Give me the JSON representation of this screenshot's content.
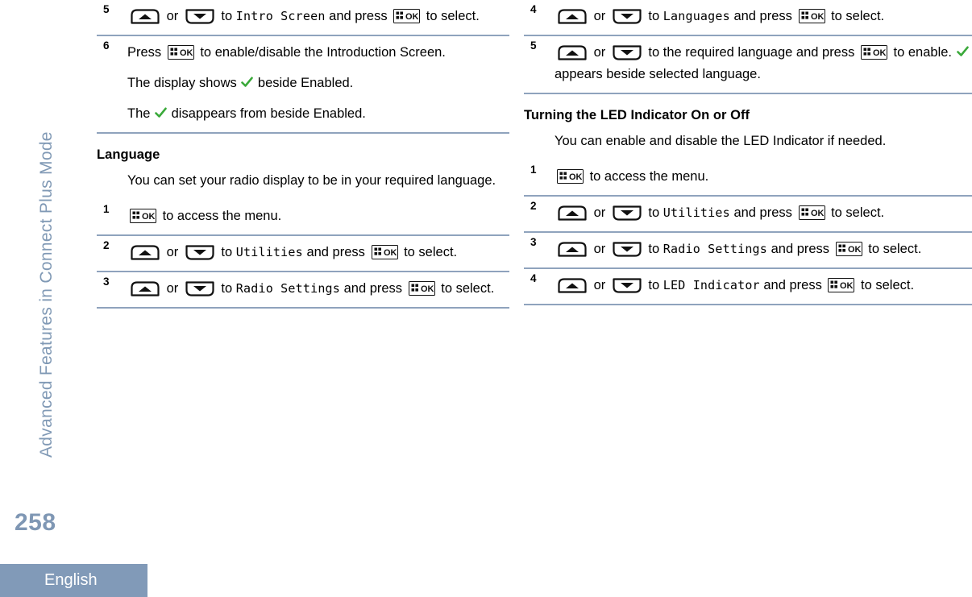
{
  "page": {
    "number": "258",
    "language_tab": "English",
    "chapter_tab": "Advanced Features in Connect Plus Mode"
  },
  "icons": {
    "ok_key": "ok-menu-key-icon",
    "up_key": "up-arrow-key-icon",
    "down_key": "down-arrow-key-icon",
    "check": "green-checkmark-icon"
  },
  "left_column": {
    "steps_top": [
      {
        "num": "5",
        "segments": [
          {
            "type": "key",
            "icon": "up_key"
          },
          {
            "type": "text",
            "value": " or "
          },
          {
            "type": "key",
            "icon": "down_key"
          },
          {
            "type": "text",
            "value": " to "
          },
          {
            "type": "mono",
            "value": "Intro Screen"
          },
          {
            "type": "text",
            "value": " and press "
          },
          {
            "type": "key",
            "icon": "ok_key"
          },
          {
            "type": "text",
            "value": " to select."
          }
        ]
      },
      {
        "num": "6",
        "segments": [
          {
            "type": "text",
            "value": "Press "
          },
          {
            "type": "key",
            "icon": "ok_key"
          },
          {
            "type": "text",
            "value": " to enable/disable the Introduction Screen."
          }
        ],
        "results": [
          [
            {
              "type": "text",
              "value": "The display shows "
            },
            {
              "type": "check"
            },
            {
              "type": "text",
              "value": " beside Enabled."
            }
          ],
          [
            {
              "type": "text",
              "value": "The "
            },
            {
              "type": "check"
            },
            {
              "type": "text",
              "value": " disappears from beside Enabled."
            }
          ]
        ]
      }
    ],
    "section": {
      "heading": "Language",
      "intro": "You can set your radio display to be in your required language.",
      "steps": [
        {
          "num": "1",
          "segments": [
            {
              "type": "key",
              "icon": "ok_key"
            },
            {
              "type": "text",
              "value": " to access the menu."
            }
          ]
        },
        {
          "num": "2",
          "segments": [
            {
              "type": "key",
              "icon": "up_key"
            },
            {
              "type": "text",
              "value": " or "
            },
            {
              "type": "key",
              "icon": "down_key"
            },
            {
              "type": "text",
              "value": " to "
            },
            {
              "type": "mono",
              "value": "Utilities"
            },
            {
              "type": "text",
              "value": " and press "
            },
            {
              "type": "key",
              "icon": "ok_key"
            },
            {
              "type": "text",
              "value": " to select."
            }
          ]
        },
        {
          "num": "3",
          "segments": [
            {
              "type": "key",
              "icon": "up_key"
            },
            {
              "type": "text",
              "value": " or "
            },
            {
              "type": "key",
              "icon": "down_key"
            },
            {
              "type": "text",
              "value": " to "
            },
            {
              "type": "mono",
              "value": "Radio Settings"
            },
            {
              "type": "text",
              "value": " and press "
            },
            {
              "type": "key",
              "icon": "ok_key"
            },
            {
              "type": "text",
              "value": " to select."
            }
          ]
        }
      ]
    }
  },
  "right_column": {
    "steps_top": [
      {
        "num": "4",
        "segments": [
          {
            "type": "key",
            "icon": "up_key"
          },
          {
            "type": "text",
            "value": " or "
          },
          {
            "type": "key",
            "icon": "down_key"
          },
          {
            "type": "text",
            "value": " to "
          },
          {
            "type": "mono",
            "value": "Languages"
          },
          {
            "type": "text",
            "value": " and press "
          },
          {
            "type": "key",
            "icon": "ok_key"
          },
          {
            "type": "text",
            "value": " to select."
          }
        ]
      },
      {
        "num": "5",
        "segments": [
          {
            "type": "key",
            "icon": "up_key"
          },
          {
            "type": "text",
            "value": " or "
          },
          {
            "type": "key",
            "icon": "down_key"
          },
          {
            "type": "text",
            "value": " to the required language and press "
          },
          {
            "type": "key",
            "icon": "ok_key"
          },
          {
            "type": "text",
            "value": " to enable. "
          },
          {
            "type": "check"
          },
          {
            "type": "text",
            "value": " appears beside selected language."
          }
        ]
      }
    ],
    "section": {
      "heading": "Turning the LED Indicator On or Off",
      "intro": "You can enable and disable the LED Indicator if needed.",
      "steps": [
        {
          "num": "1",
          "segments": [
            {
              "type": "key",
              "icon": "ok_key"
            },
            {
              "type": "text",
              "value": " to access the menu."
            }
          ]
        },
        {
          "num": "2",
          "segments": [
            {
              "type": "key",
              "icon": "up_key"
            },
            {
              "type": "text",
              "value": " or "
            },
            {
              "type": "key",
              "icon": "down_key"
            },
            {
              "type": "text",
              "value": " to "
            },
            {
              "type": "mono",
              "value": "Utilities"
            },
            {
              "type": "text",
              "value": " and press "
            },
            {
              "type": "key",
              "icon": "ok_key"
            },
            {
              "type": "text",
              "value": " to select."
            }
          ]
        },
        {
          "num": "3",
          "segments": [
            {
              "type": "key",
              "icon": "up_key"
            },
            {
              "type": "text",
              "value": " or "
            },
            {
              "type": "key",
              "icon": "down_key"
            },
            {
              "type": "text",
              "value": " to "
            },
            {
              "type": "mono",
              "value": "Radio Settings"
            },
            {
              "type": "text",
              "value": " and press "
            },
            {
              "type": "key",
              "icon": "ok_key"
            },
            {
              "type": "text",
              "value": " to select."
            }
          ]
        },
        {
          "num": "4",
          "segments": [
            {
              "type": "key",
              "icon": "up_key"
            },
            {
              "type": "text",
              "value": " or "
            },
            {
              "type": "key",
              "icon": "down_key"
            },
            {
              "type": "text",
              "value": " to "
            },
            {
              "type": "mono",
              "value": "LED Indicator"
            },
            {
              "type": "text",
              "value": " and press "
            },
            {
              "type": "key",
              "icon": "ok_key"
            },
            {
              "type": "text",
              "value": " to select."
            }
          ]
        }
      ]
    }
  },
  "colors": {
    "accent": "#819ab8",
    "divider": "#8fa3bd",
    "check_green": "#3aa93a",
    "tab_text": "#8099b5"
  }
}
